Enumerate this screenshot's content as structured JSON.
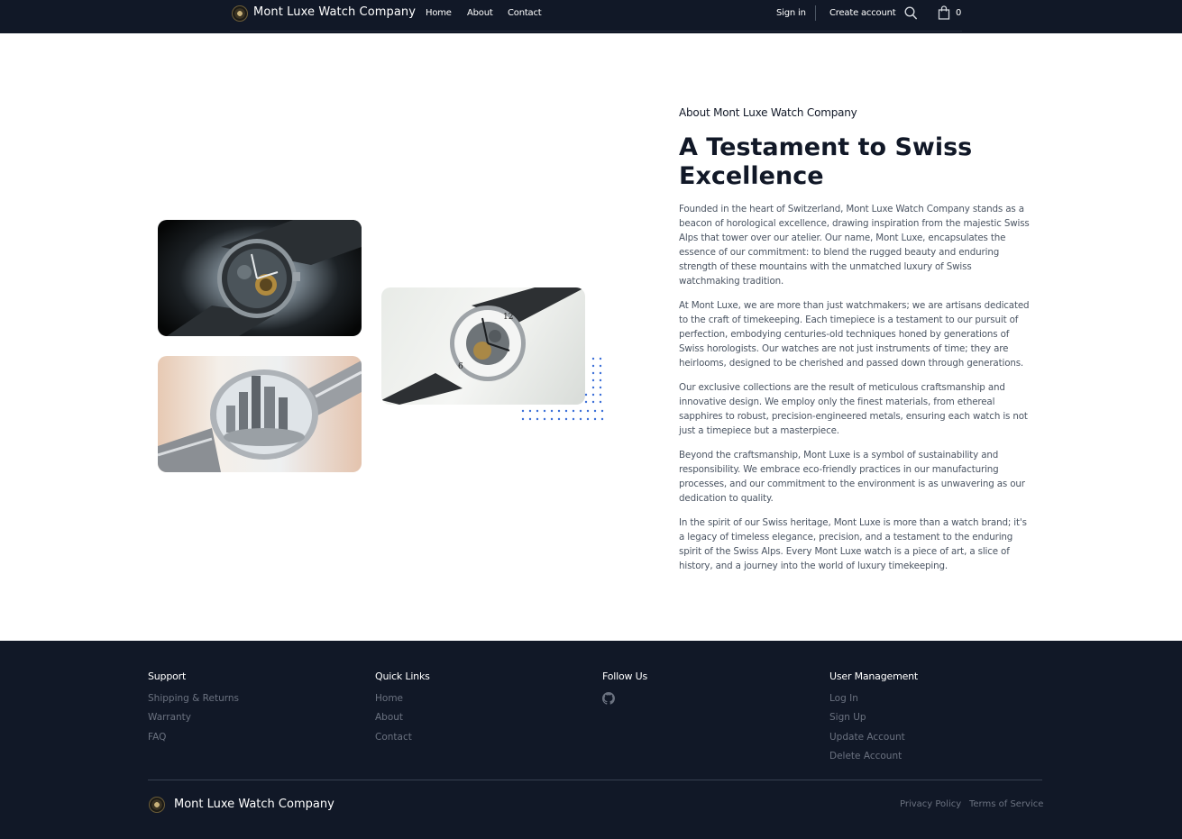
{
  "header": {
    "brand": "Mont Luxe Watch Company",
    "nav": [
      "Home",
      "About",
      "Contact"
    ],
    "sign_in": "Sign in",
    "create_account": "Create account",
    "cart_count": "0"
  },
  "about": {
    "eyebrow": "About Mont Luxe Watch Company",
    "title": "A Testament to Swiss Excellence",
    "paragraphs": [
      "Founded in the heart of Switzerland, Mont Luxe Watch Company stands as a beacon of horological excellence, drawing inspiration from the majestic Swiss Alps that tower over our atelier. Our name, Mont Luxe, encapsulates the essence of our commitment: to blend the rugged beauty and enduring strength of these mountains with the unmatched luxury of Swiss watchmaking tradition.",
      "At Mont Luxe, we are more than just watchmakers; we are artisans dedicated to the craft of timekeeping. Each timepiece is a testament to our pursuit of perfection, embodying centuries-old techniques honed by generations of Swiss horologists. Our watches are not just instruments of time; they are heirlooms, designed to be cherished and passed down through generations.",
      "Our exclusive collections are the result of meticulous craftsmanship and innovative design. We employ only the finest materials, from ethereal sapphires to robust, precision-engineered metals, ensuring each watch is not just a timepiece but a masterpiece.",
      "Beyond the craftsmanship, Mont Luxe is a symbol of sustainability and responsibility. We embrace eco-friendly practices in our manufacturing processes, and our commitment to the environment is as unwavering as our dedication to quality.",
      "In the spirit of our Swiss heritage, Mont Luxe is more than a watch brand; it's a legacy of timeless elegance, precision, and a testament to the enduring spirit of the Swiss Alps. Every Mont Luxe watch is a piece of art, a slice of history, and a journey into the world of luxury timekeeping."
    ]
  },
  "footer": {
    "support": {
      "heading": "Support",
      "links": [
        "Shipping & Returns",
        "Warranty",
        "FAQ"
      ]
    },
    "quick_links": {
      "heading": "Quick Links",
      "links": [
        "Home",
        "About",
        "Contact"
      ]
    },
    "follow": {
      "heading": "Follow Us",
      "icon": "github-icon"
    },
    "user_management": {
      "heading": "User Management",
      "links": [
        "Log In",
        "Sign Up",
        "Update Account",
        "Delete Account"
      ]
    },
    "brand": "Mont Luxe Watch Company",
    "privacy": "Privacy Policy",
    "terms": "Terms of Service"
  },
  "colors": {
    "dark": "#111827",
    "accent_dots": "#3b6fd8",
    "muted_text": "#6b7280"
  }
}
